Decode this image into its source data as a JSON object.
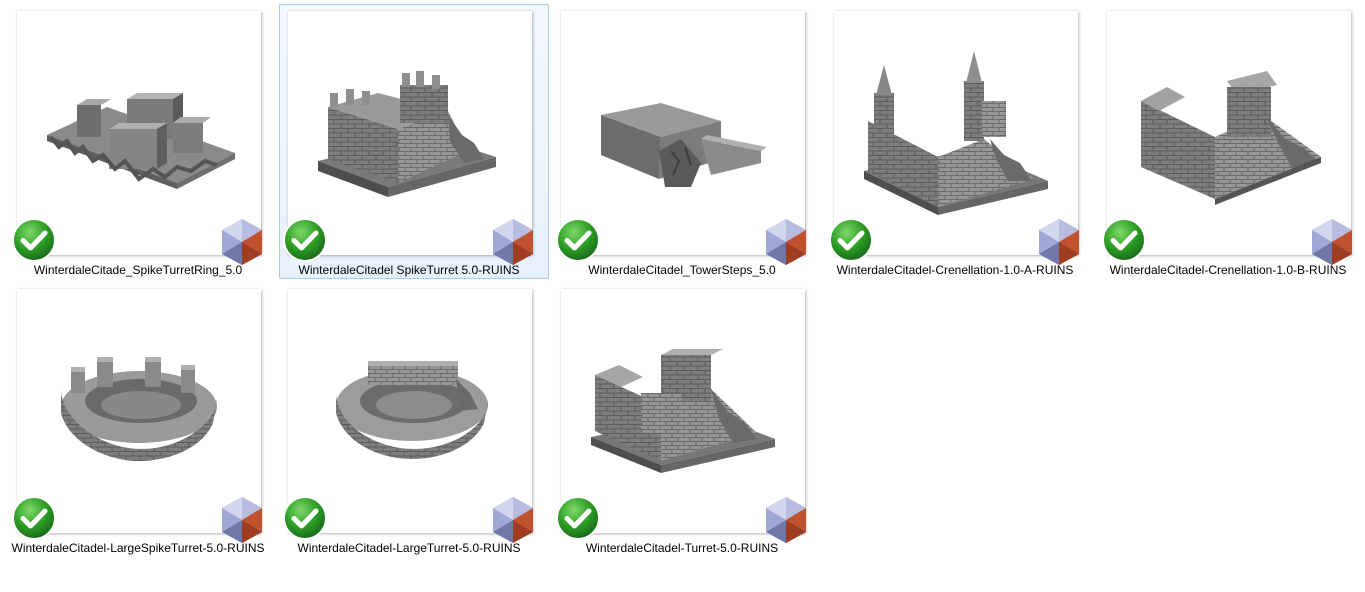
{
  "files": [
    {
      "name": "WinterdaleCitade_SpikeTurretRing_5.0",
      "status_icon": "checkmark-icon",
      "app_icon": "3d-viewer-app-icon",
      "selected": false
    },
    {
      "name": "WinterdaleCitadel SpikeTurret 5.0-RUINS",
      "status_icon": "checkmark-icon",
      "app_icon": "3d-viewer-app-icon",
      "selected": true
    },
    {
      "name": "WinterdaleCitadel_TowerSteps_5.0",
      "status_icon": "checkmark-icon",
      "app_icon": "3d-viewer-app-icon",
      "selected": false
    },
    {
      "name": "WinterdaleCitadel-Crenellation-1.0-A-RUINS",
      "status_icon": "checkmark-icon",
      "app_icon": "3d-viewer-app-icon",
      "selected": false
    },
    {
      "name": "WinterdaleCitadel-Crenellation-1.0-B-RUINS",
      "status_icon": "checkmark-icon",
      "app_icon": "3d-viewer-app-icon",
      "selected": false
    },
    {
      "name": "WinterdaleCitadel-LargeSpikeTurret-5.0-RUINS",
      "status_icon": "checkmark-icon",
      "app_icon": "3d-viewer-app-icon",
      "selected": false
    },
    {
      "name": "WinterdaleCitadel-LargeTurret-5.0-RUINS",
      "status_icon": "checkmark-icon",
      "app_icon": "3d-viewer-app-icon",
      "selected": false
    },
    {
      "name": "WinterdaleCitadel-Turret-5.0-RUINS",
      "status_icon": "checkmark-icon",
      "app_icon": "3d-viewer-app-icon",
      "selected": false
    }
  ],
  "colors": {
    "selection_fill": "#e8f1fc",
    "selection_border": "#a8cbf0",
    "check_green": "#2e9e25",
    "model_gray": "#8a8a8a",
    "app_red": "#c0522f",
    "app_blue": "#8d97c8"
  }
}
